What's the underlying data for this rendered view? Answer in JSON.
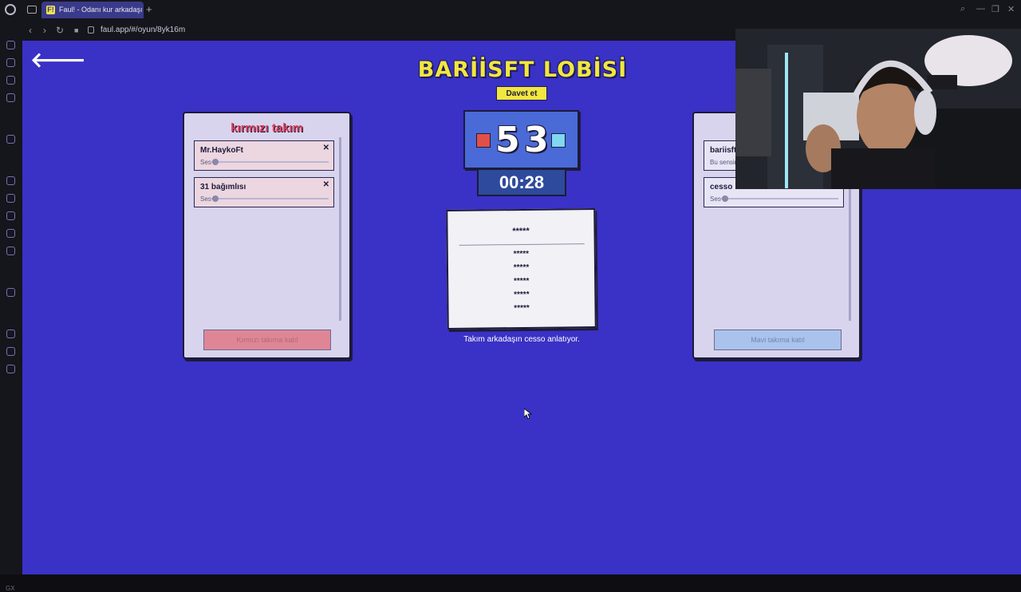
{
  "browser": {
    "tab_title": "Faul! - Odanı kur arkadaşı",
    "favicon_letter": "F!",
    "new_tab": "+",
    "url": "faul.app/#/oyun/8yk16m"
  },
  "lobby": {
    "title": "BARİİSFT LOBİSİ",
    "invite_label": "Davet et"
  },
  "red_team": {
    "title": "kırmızı takım",
    "players": [
      {
        "name": "Mr.HaykoFt",
        "vol_label": "Ses"
      },
      {
        "name": "31 bağımlısı",
        "vol_label": "Ses"
      }
    ],
    "join_label": "Kırmızı takıma katıl"
  },
  "blue_team": {
    "players": [
      {
        "name": "bariisft",
        "subtitle": "Bu sensin"
      },
      {
        "name": "cesso",
        "vol_label": "Ses"
      }
    ],
    "join_label": "Mavi takıma katıl"
  },
  "score": {
    "red": "5",
    "blue": "3",
    "timer": "00:28"
  },
  "card": {
    "main_word": "*****",
    "taboo_words": [
      "*****",
      "*****",
      "*****",
      "*****",
      "*****"
    ]
  },
  "status": "Takım arkadaşın cesso anlatıyor.",
  "colors": {
    "background": "#3a31c6",
    "red": "#e05048",
    "blue": "#7fd8f0",
    "accent_yellow": "#f2e640"
  }
}
